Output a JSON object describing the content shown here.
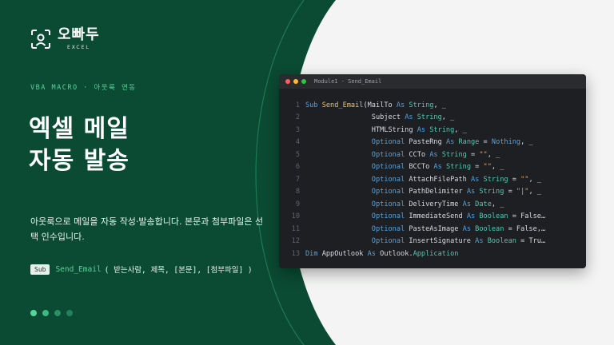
{
  "brand": {
    "title": "오빠두",
    "subtitle": "EXCEL"
  },
  "eyebrow": "VBA MACRO · 아웃룩 연동",
  "headline": [
    "엑셀 메일",
    "자동 발송"
  ],
  "description": "아웃룩으로 메일을 자동 작성·발송합니다. 본문과 첨부파일은 선택 인수입니다.",
  "signature": {
    "keyword": "Sub",
    "name": "Send_Email",
    "params": "( 받는사람, 제목, [본문], [첨부파일] )"
  },
  "pagination": {
    "total": 4,
    "active": 1
  },
  "editor": {
    "title": "Module1 · Send_Email",
    "lines": [
      {
        "n": "1",
        "tokens": [
          [
            "kw",
            "Sub "
          ],
          [
            "fn",
            "Send_Email"
          ],
          [
            "plain",
            "(MailTo "
          ],
          [
            "kw",
            "As "
          ],
          [
            "type",
            "String"
          ],
          [
            "plain",
            ", _"
          ]
        ]
      },
      {
        "n": "2",
        "tokens": [
          [
            "plain",
            "                Subject "
          ],
          [
            "kw",
            "As "
          ],
          [
            "type",
            "String"
          ],
          [
            "plain",
            ", _"
          ]
        ]
      },
      {
        "n": "3",
        "tokens": [
          [
            "plain",
            "                HTMLString "
          ],
          [
            "kw",
            "As "
          ],
          [
            "type",
            "String"
          ],
          [
            "plain",
            ", _"
          ]
        ]
      },
      {
        "n": "4",
        "tokens": [
          [
            "plain",
            "                "
          ],
          [
            "kw",
            "Optional "
          ],
          [
            "plain",
            "PasteRng "
          ],
          [
            "kw",
            "As "
          ],
          [
            "type",
            "Range"
          ],
          [
            "plain",
            " = "
          ],
          [
            "kw",
            "Nothing"
          ],
          [
            "plain",
            ", _"
          ]
        ]
      },
      {
        "n": "5",
        "tokens": [
          [
            "plain",
            "                "
          ],
          [
            "kw",
            "Optional "
          ],
          [
            "plain",
            "CCTo "
          ],
          [
            "kw",
            "As "
          ],
          [
            "type",
            "String"
          ],
          [
            "plain",
            " = "
          ],
          [
            "str",
            "\"\""
          ],
          [
            "plain",
            ", _"
          ]
        ]
      },
      {
        "n": "6",
        "tokens": [
          [
            "plain",
            "                "
          ],
          [
            "kw",
            "Optional "
          ],
          [
            "plain",
            "BCCTo "
          ],
          [
            "kw",
            "As "
          ],
          [
            "type",
            "String"
          ],
          [
            "plain",
            " = "
          ],
          [
            "str",
            "\"\""
          ],
          [
            "plain",
            ", _"
          ]
        ]
      },
      {
        "n": "7",
        "tokens": [
          [
            "plain",
            "                "
          ],
          [
            "kw",
            "Optional "
          ],
          [
            "plain",
            "AttachFilePath "
          ],
          [
            "kw",
            "As "
          ],
          [
            "type",
            "String"
          ],
          [
            "plain",
            " = "
          ],
          [
            "str",
            "\"\""
          ],
          [
            "plain",
            ", _"
          ]
        ]
      },
      {
        "n": "8",
        "tokens": [
          [
            "plain",
            "                "
          ],
          [
            "kw",
            "Optional "
          ],
          [
            "plain",
            "PathDelimiter "
          ],
          [
            "kw",
            "As "
          ],
          [
            "type",
            "String"
          ],
          [
            "plain",
            " = "
          ],
          [
            "str",
            "\"|\""
          ],
          [
            "plain",
            ", _"
          ]
        ]
      },
      {
        "n": "9",
        "tokens": [
          [
            "plain",
            "                "
          ],
          [
            "kw",
            "Optional "
          ],
          [
            "plain",
            "DeliveryTime "
          ],
          [
            "kw",
            "As "
          ],
          [
            "type",
            "Date"
          ],
          [
            "plain",
            ", _"
          ]
        ]
      },
      {
        "n": "10",
        "tokens": [
          [
            "plain",
            "                "
          ],
          [
            "kw",
            "Optional "
          ],
          [
            "plain",
            "ImmediateSend "
          ],
          [
            "kw",
            "As "
          ],
          [
            "type",
            "Boolean"
          ],
          [
            "plain",
            " = False…"
          ]
        ]
      },
      {
        "n": "11",
        "tokens": [
          [
            "plain",
            "                "
          ],
          [
            "kw",
            "Optional "
          ],
          [
            "plain",
            "PasteAsImage "
          ],
          [
            "kw",
            "As "
          ],
          [
            "type",
            "Boolean"
          ],
          [
            "plain",
            " = False,…"
          ]
        ]
      },
      {
        "n": "12",
        "tokens": [
          [
            "plain",
            "                "
          ],
          [
            "kw",
            "Optional "
          ],
          [
            "plain",
            "InsertSignature "
          ],
          [
            "kw",
            "As "
          ],
          [
            "type",
            "Boolean"
          ],
          [
            "plain",
            " = Tru…"
          ]
        ]
      },
      {
        "n": "13",
        "tokens": [
          [
            "kw",
            "Dim "
          ],
          [
            "plain",
            "AppOutlook "
          ],
          [
            "kw",
            "As "
          ],
          [
            "plain",
            "Outlook."
          ],
          [
            "type",
            "Application"
          ]
        ]
      }
    ]
  },
  "colors": {
    "dark_green": "#0b4a33",
    "light_bg": "#f3f4f3",
    "accent": "#57d39b",
    "editor_bg": "#1e1f22"
  }
}
